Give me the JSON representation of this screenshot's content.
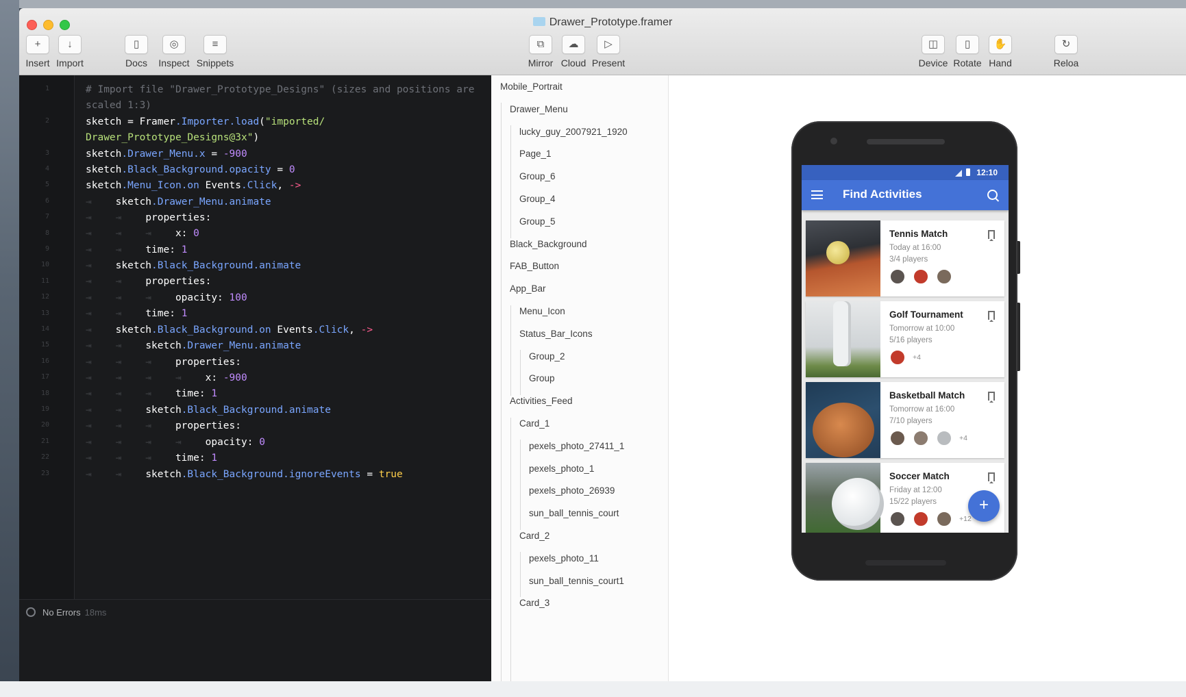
{
  "window": {
    "title": "Drawer_Prototype.framer"
  },
  "toolbar": {
    "insert": "Insert",
    "import": "Import",
    "docs": "Docs",
    "inspect": "Inspect",
    "snippets": "Snippets",
    "mirror": "Mirror",
    "cloud": "Cloud",
    "present": "Present",
    "device": "Device",
    "rotate": "Rotate",
    "hand": "Hand",
    "reload": "Reloa"
  },
  "editor": {
    "line_numbers": [
      "1",
      "",
      "2",
      "",
      "3",
      "4",
      "5",
      "6",
      "7",
      "8",
      "9",
      "10",
      "11",
      "12",
      "13",
      "14",
      "15",
      "16",
      "17",
      "18",
      "19",
      "20",
      "21",
      "22",
      "23"
    ],
    "status": "No Errors",
    "status_time": "18ms"
  },
  "layers": [
    {
      "label": "Mobile_Portrait",
      "depth": 0
    },
    {
      "label": "Drawer_Menu",
      "depth": 1
    },
    {
      "label": "lucky_guy_2007921_1920",
      "depth": 2
    },
    {
      "label": "Page_1",
      "depth": 2
    },
    {
      "label": "Group_6",
      "depth": 2
    },
    {
      "label": "Group_4",
      "depth": 2
    },
    {
      "label": "Group_5",
      "depth": 2
    },
    {
      "label": "Black_Background",
      "depth": 1
    },
    {
      "label": "FAB_Button",
      "depth": 1
    },
    {
      "label": "App_Bar",
      "depth": 1
    },
    {
      "label": "Menu_Icon",
      "depth": 2
    },
    {
      "label": "Status_Bar_Icons",
      "depth": 2
    },
    {
      "label": "Group_2",
      "depth": 3
    },
    {
      "label": "Group",
      "depth": 3
    },
    {
      "label": "Activities_Feed",
      "depth": 1
    },
    {
      "label": "Card_1",
      "depth": 2
    },
    {
      "label": "pexels_photo_27411_1",
      "depth": 3
    },
    {
      "label": "pexels_photo_1",
      "depth": 3
    },
    {
      "label": "pexels_photo_26939",
      "depth": 3
    },
    {
      "label": "sun_ball_tennis_court",
      "depth": 3
    },
    {
      "label": "Card_2",
      "depth": 2
    },
    {
      "label": "pexels_photo_11",
      "depth": 3
    },
    {
      "label": "sun_ball_tennis_court1",
      "depth": 3
    },
    {
      "label": "Card_3",
      "depth": 2
    }
  ],
  "phone": {
    "time": "12:10",
    "app_title": "Find Activities",
    "fab_label": "+",
    "cards": [
      {
        "title": "Tennis Match",
        "when": "Today at 16:00",
        "players": "3/4 players",
        "more": ""
      },
      {
        "title": "Golf Tournament",
        "when": "Tomorrow at 10:00",
        "players": "5/16 players",
        "more": "+4"
      },
      {
        "title": "Basketball Match",
        "when": "Tomorrow at 16:00",
        "players": "7/10 players",
        "more": "+4"
      },
      {
        "title": "Soccer Match",
        "when": "Friday at 12:00",
        "players": "15/22 players",
        "more": "+12"
      }
    ]
  },
  "colors": {
    "app_bar": "#4472d7",
    "status_bar": "#3761bf",
    "editor_bg": "#1a1b1d"
  }
}
